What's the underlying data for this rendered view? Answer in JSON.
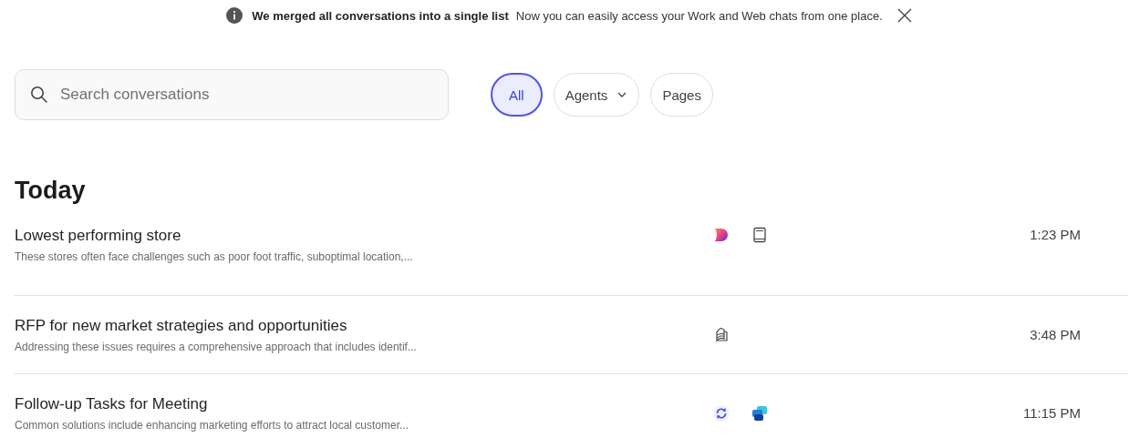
{
  "banner": {
    "title": "We merged all conversations into a single list",
    "message": "Now you can easily access your Work and Web chats from one place."
  },
  "search": {
    "placeholder": "Search conversations"
  },
  "filters": [
    {
      "label": "All",
      "selected": true,
      "has_menu": false
    },
    {
      "label": "Agents",
      "selected": false,
      "has_menu": true
    },
    {
      "label": "Pages",
      "selected": false,
      "has_menu": false
    }
  ],
  "section": {
    "title": "Today"
  },
  "conversations": [
    {
      "title": "Lowest performing store",
      "preview": "These stores often face challenges such as poor foot traffic, suboptimal location,...",
      "icons": [
        {
          "kind": "gradient"
        },
        {
          "kind": "book"
        }
      ],
      "time": "1:23 PM"
    },
    {
      "title": "RFP for new market strategies and opportunities",
      "preview": "Addressing these issues requires a comprehensive approach that includes identif...",
      "icons": [
        {
          "kind": "notebook"
        }
      ],
      "time": "3:48 PM"
    },
    {
      "title": "Follow-up Tasks for Meeting",
      "preview": "Common solutions include enhancing marketing efforts to attract local customer...",
      "icons": [
        {
          "kind": "sync"
        },
        {
          "kind": "blocks"
        }
      ],
      "time": "11:15 PM"
    }
  ]
}
